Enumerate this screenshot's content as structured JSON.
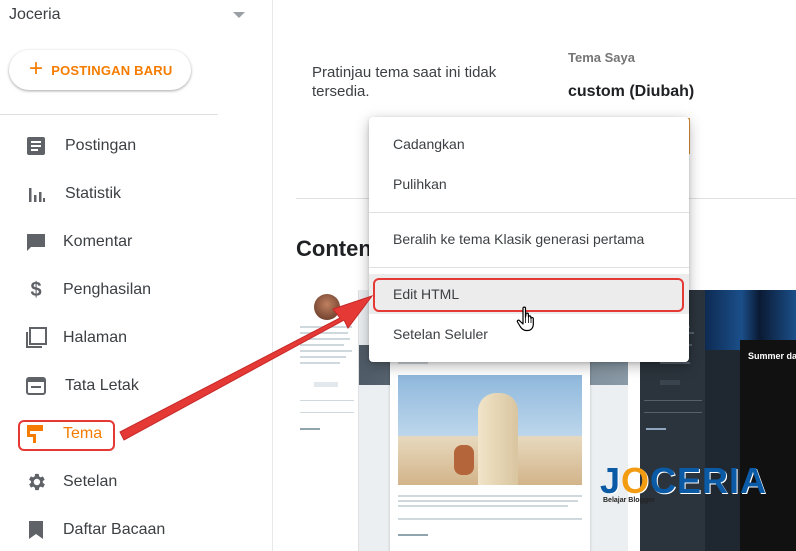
{
  "sidebar": {
    "blog_name": "Joceria",
    "new_post_label": "POSTINGAN BARU",
    "items": [
      {
        "label": "Postingan",
        "icon": "posts-icon"
      },
      {
        "label": "Statistik",
        "icon": "stats-icon"
      },
      {
        "label": "Komentar",
        "icon": "comment-icon"
      },
      {
        "label": "Penghasilan",
        "icon": "dollar-icon"
      },
      {
        "label": "Halaman",
        "icon": "pages-icon"
      },
      {
        "label": "Tata Letak",
        "icon": "layout-icon"
      },
      {
        "label": "Tema",
        "icon": "theme-roller-icon",
        "active": true
      },
      {
        "label": "Setelan",
        "icon": "gear-icon"
      },
      {
        "label": "Daftar Bacaan",
        "icon": "bookmark-icon"
      }
    ]
  },
  "main": {
    "preview_unavailable": "Pratinjau tema saat ini tidak tersedia.",
    "my_theme_label": "Tema Saya",
    "my_theme_name": "custom (Diubah)",
    "section_title": "Conten"
  },
  "menu": {
    "items": [
      {
        "label": "Cadangkan"
      },
      {
        "label": "Pulihkan"
      },
      {
        "label": "Beralih ke tema Klasik generasi pertama"
      },
      {
        "label": "Edit HTML",
        "highlighted": true
      },
      {
        "label": "Setelan Seluler"
      }
    ]
  },
  "thumbnails": {
    "dark_post_title": "Summer days in"
  },
  "watermark": {
    "text_j": "J",
    "text_o": "O",
    "text_rest": "CERIA",
    "tagline": "Belajar Blogger"
  },
  "colors": {
    "accent": "#f57c00",
    "annotation_red": "#e53935",
    "text": "#3c4043"
  }
}
